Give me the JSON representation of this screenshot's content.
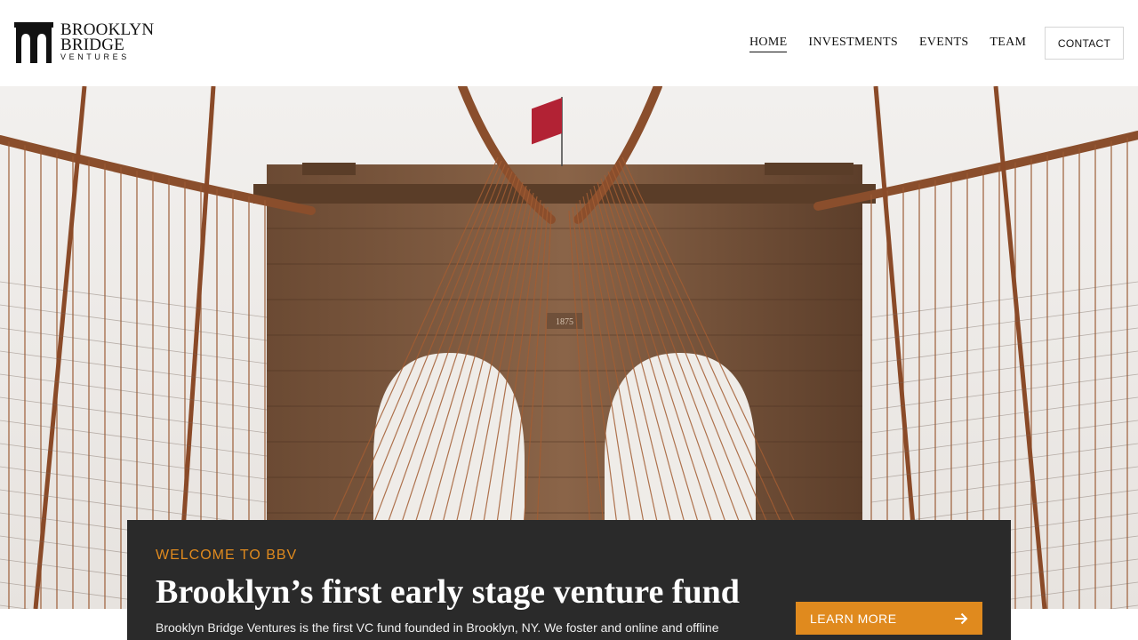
{
  "brand": {
    "line1": "BROOKLYN",
    "line2": "BRIDGE",
    "line3": "VENTURES"
  },
  "nav": {
    "items": [
      {
        "label": "HOME",
        "active": true
      },
      {
        "label": "INVESTMENTS",
        "active": false
      },
      {
        "label": "EVENTS",
        "active": false
      },
      {
        "label": "TEAM",
        "active": false
      }
    ],
    "contact_label": "CONTACT"
  },
  "hero": {
    "image_subject": "brooklyn-bridge-tower",
    "plaque": "1875"
  },
  "card": {
    "eyebrow": "WELCOME TO BBV",
    "title": "Brooklyn’s first early stage venture fund",
    "body": "Brooklyn Bridge Ventures is the first VC fund founded in Brooklyn, NY. We foster and online and offline",
    "button_label": "LEARN MORE",
    "button_icon": "arrow-right-icon"
  },
  "colors": {
    "accent": "#e08a1e",
    "card_bg": "#2a2a2a",
    "text": "#111111"
  }
}
